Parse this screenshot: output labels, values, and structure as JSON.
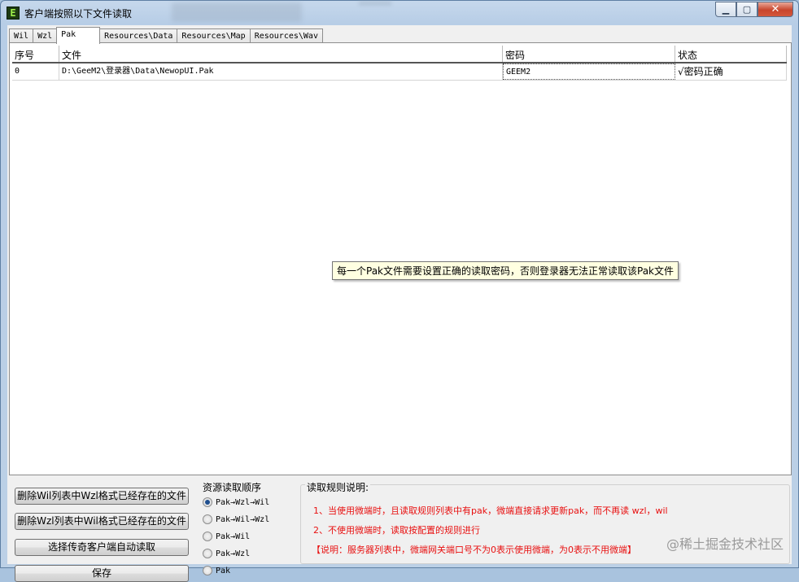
{
  "window": {
    "title": "客户端按照以下文件读取"
  },
  "icons": {
    "app": "app-e-icon",
    "minimize": "minimize-icon",
    "maximize": "maximize-icon",
    "close": "close-icon",
    "app_letter": "E",
    "minimize_glyph": "▁",
    "maximize_glyph": "▢",
    "close_glyph": "✕"
  },
  "tabs": [
    {
      "label": "Wil"
    },
    {
      "label": "Wzl"
    },
    {
      "label": "Pak",
      "active": true
    },
    {
      "label": "Resources\\Data"
    },
    {
      "label": "Resources\\Map"
    },
    {
      "label": "Resources\\Wav"
    }
  ],
  "grid": {
    "columns": [
      "序号",
      "文件",
      "密码",
      "状态"
    ],
    "rows": [
      {
        "index": "0",
        "file": "D:\\GeeM2\\登录器\\Data\\NewopUI.Pak",
        "password": "GEEM2",
        "status": "√密码正确"
      }
    ]
  },
  "tooltip": "每一个Pak文件需要设置正确的读取密码，否则登录器无法正常读取该Pak文件",
  "buttons": {
    "delete_wil": "删除Wil列表中Wzl格式已经存在的文件",
    "delete_wzl": "删除Wzl列表中Wil格式已经存在的文件",
    "choose_client": "选择传奇客户端自动读取",
    "save": "保存"
  },
  "read_order": {
    "title": "资源读取顺序",
    "options": [
      "Pak→Wzl→Wil",
      "Pak→Wil→Wzl",
      "Pak→Wil",
      "Pak→Wzl",
      "Pak"
    ],
    "selected": "Pak→Wzl→Wil"
  },
  "rules": {
    "title": "读取规则说明:",
    "line1": "1、当使用微端时，且读取规则列表中有pak，微端直接请求更新pak，而不再读 wzl，wil",
    "line2": "2、不使用微端时，读取按配置的规则进行",
    "line3": "【说明：服务器列表中，微端网关端口号不为0表示使用微端，为0表示不用微端】",
    "color": "#e81010"
  },
  "watermark": "@稀土掘金技术社区"
}
